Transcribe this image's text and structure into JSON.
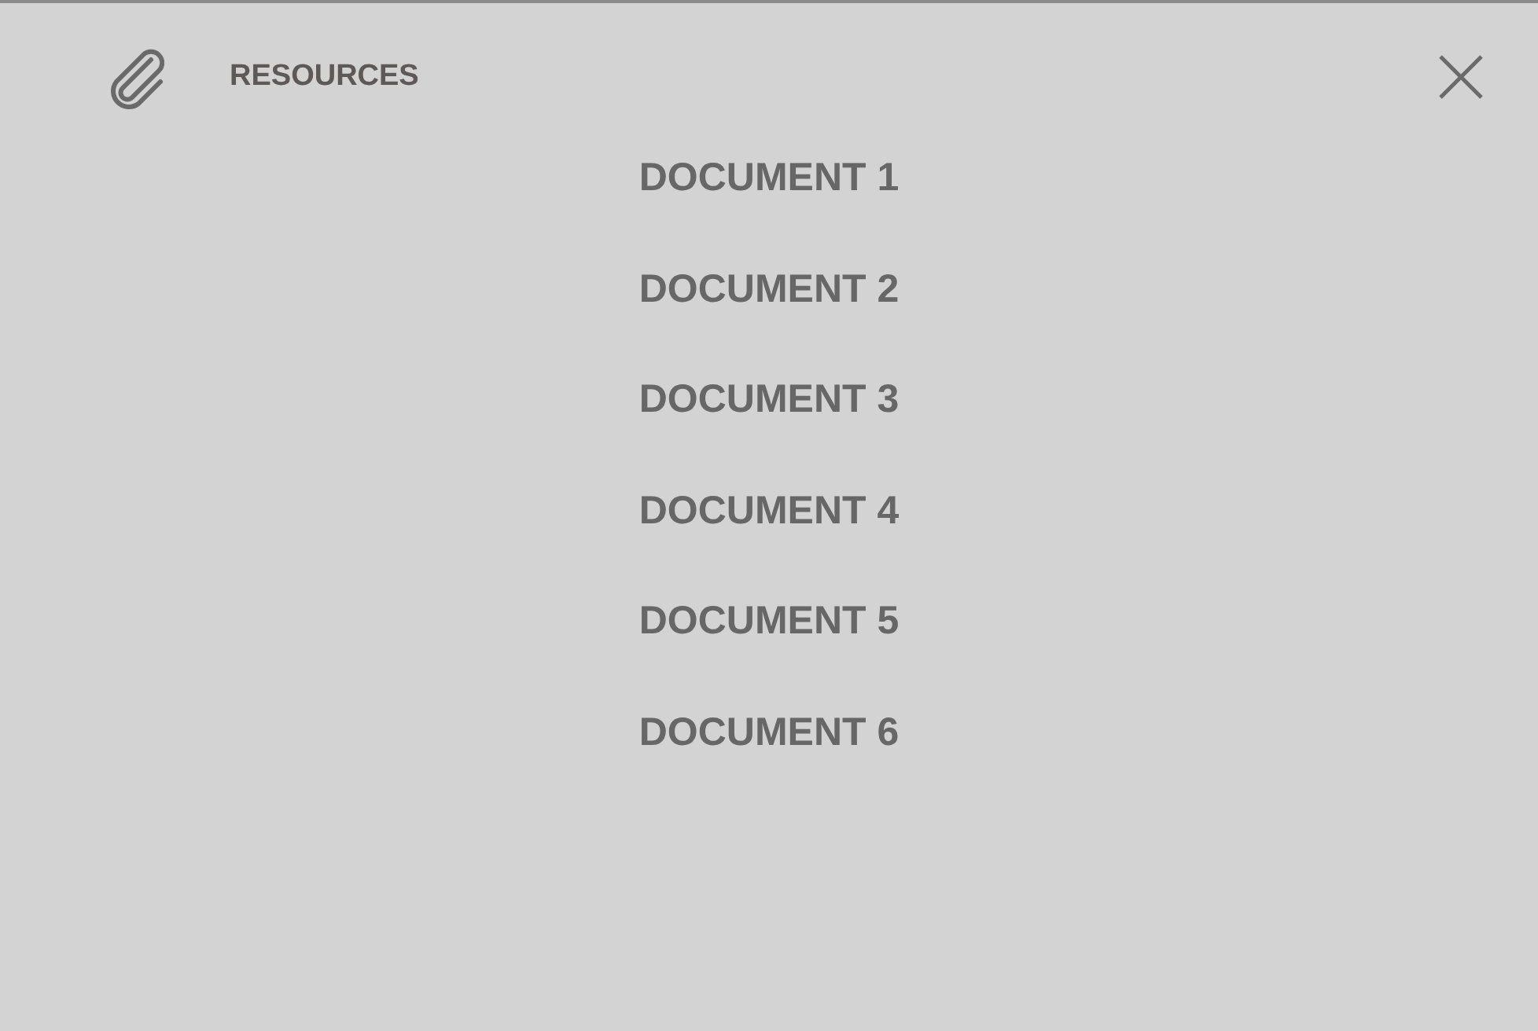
{
  "header": {
    "title": "RESOURCES"
  },
  "documents": [
    {
      "label": "DOCUMENT 1"
    },
    {
      "label": "DOCUMENT 2"
    },
    {
      "label": "DOCUMENT 3"
    },
    {
      "label": "DOCUMENT 4"
    },
    {
      "label": "DOCUMENT 5"
    },
    {
      "label": "DOCUMENT 6"
    }
  ]
}
